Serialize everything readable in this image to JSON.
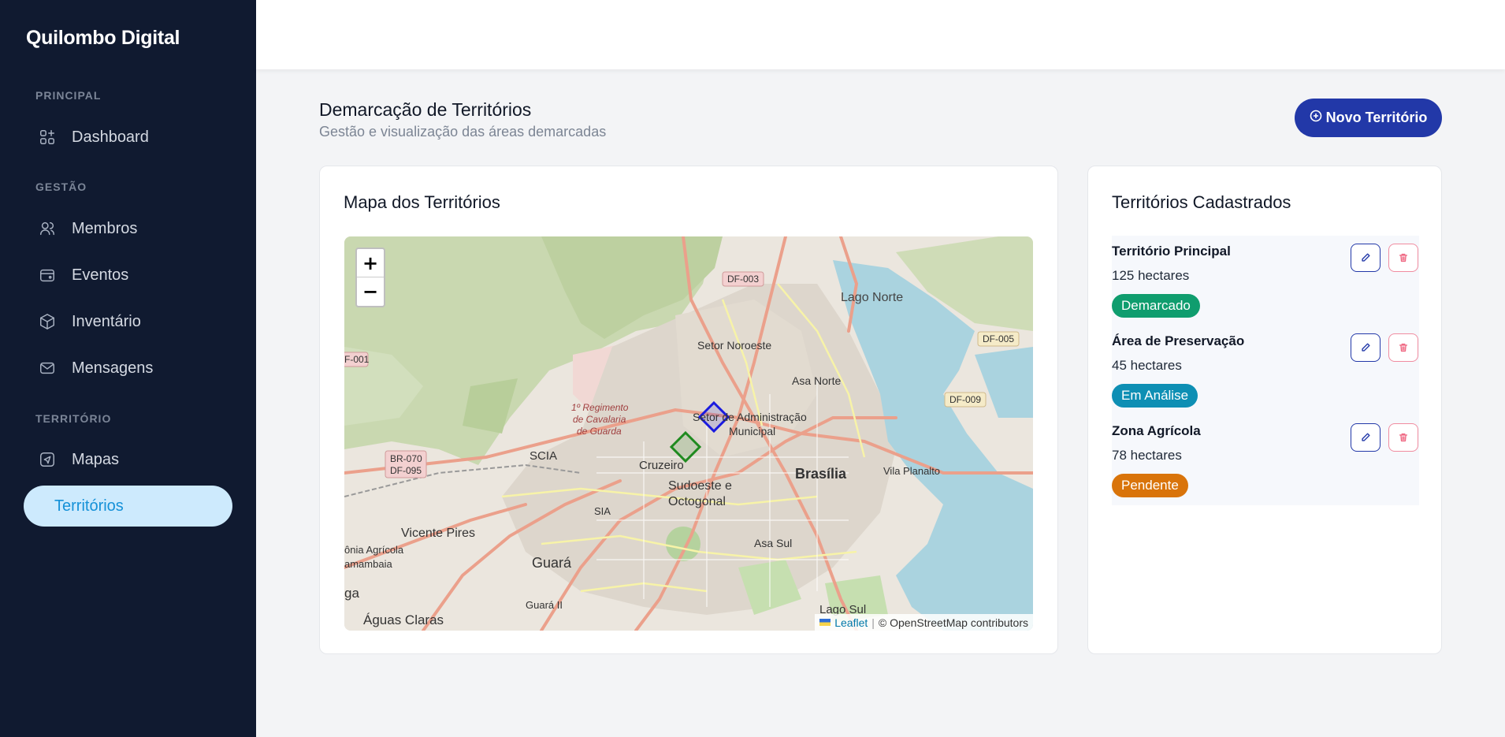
{
  "app": {
    "title": "Quilombo Digital"
  },
  "sidebar": {
    "sections": [
      {
        "label": "PRINCIPAL"
      },
      {
        "label": "GESTÃO"
      },
      {
        "label": "TERRITÓRIO"
      }
    ],
    "items": [
      {
        "label": "Dashboard",
        "icon": "dashboard-icon"
      },
      {
        "label": "Membros",
        "icon": "users-icon"
      },
      {
        "label": "Eventos",
        "icon": "calendar-icon"
      },
      {
        "label": "Inventário",
        "icon": "box-icon"
      },
      {
        "label": "Mensagens",
        "icon": "mail-icon"
      },
      {
        "label": "Mapas",
        "icon": "map-icon"
      },
      {
        "label": "Territórios",
        "icon": "territory",
        "active": true
      }
    ]
  },
  "page": {
    "title": "Demarcação de Territórios",
    "subtitle": "Gestão e visualização das áreas demarcadas",
    "new_button": "Novo Território"
  },
  "map_card": {
    "title": "Mapa dos Territórios",
    "zoom_in": "+",
    "zoom_out": "−",
    "attribution_link": "Leaflet",
    "attribution_sep": "|",
    "attribution_text": "© OpenStreetMap contributors",
    "labels": {
      "df003": "DF-003",
      "lago_norte": "Lago Norte",
      "df005": "DF-005",
      "df001": "F-001",
      "setor_noroeste": "Setor Noroeste",
      "asa_norte": "Asa Norte",
      "df009": "DF-009",
      "regimento_1": "1º Regimento",
      "regimento_2": "de Cavalaria",
      "regimento_3": "de Guarda",
      "setor_adm_1": "Setor de Administração",
      "setor_adm_2": "Municipal",
      "scia": "SCIA",
      "br070": "BR-070",
      "df095": "DF-095",
      "cruzeiro": "Cruzeiro",
      "brasilia": "Brasília",
      "vila_planalto": "Vila Planalto",
      "sudoeste_1": "Sudoeste e",
      "sudoeste_2": "Octogonal",
      "sia": "SIA",
      "vicente_pires": "Vicente Pires",
      "colonia_1": "ônia Agrícola",
      "colonia_2": "amambaia",
      "guara": "Guará",
      "asa_sul": "Asa Sul",
      "ga": "ga",
      "guara_ii": "Guará II",
      "aguas_claras": "Águas Claras",
      "lago_sul": "Lago Sul"
    },
    "polygons": [
      {
        "name": "Território Principal",
        "color": "#1a1adf"
      },
      {
        "name": "Área de Preservação",
        "color": "#1f8a1f"
      }
    ]
  },
  "list_card": {
    "title": "Territórios Cadastrados",
    "items": [
      {
        "name": "Território Principal",
        "area": "125 hectares",
        "status": "Demarcado",
        "status_color": "#0f9d6e"
      },
      {
        "name": "Área de Preservação",
        "area": "45 hectares",
        "status": "Em Análise",
        "status_color": "#0e8fb4"
      },
      {
        "name": "Zona Agrícola",
        "area": "78 hectares",
        "status": "Pendente",
        "status_color": "#d9740a"
      }
    ]
  }
}
